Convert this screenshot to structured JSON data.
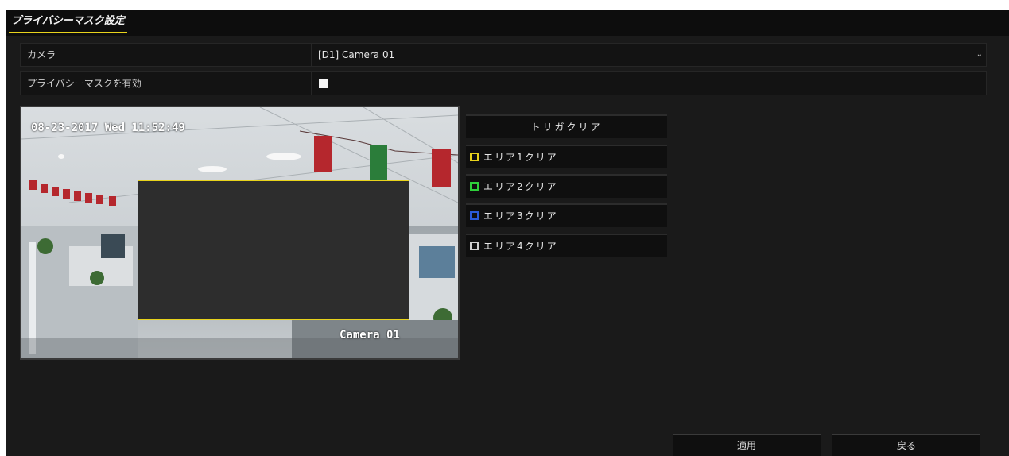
{
  "tab": {
    "label": "プライバシーマスク設定"
  },
  "form": {
    "camera_label": "カメラ",
    "camera_value": "[D1] Camera 01",
    "enable_label": "プライバシーマスクを有効"
  },
  "preview": {
    "osd_timestamp": "08-23-2017 Wed 11:52:49",
    "osd_camera_name": "Camera 01"
  },
  "clear_panel": {
    "trigger_clear": "トリガクリア",
    "areas": [
      {
        "label": "エリア1クリア",
        "color": "#e8d31c"
      },
      {
        "label": "エリア2クリア",
        "color": "#2ecf3a"
      },
      {
        "label": "エリア3クリア",
        "color": "#2a5bd8"
      },
      {
        "label": "エリア4クリア",
        "color": "#cfcfcf"
      }
    ]
  },
  "footer": {
    "apply_label": "適用",
    "back_label": "戻る"
  },
  "colors": {
    "accent": "#e8d31c",
    "background": "#1a1a1a"
  }
}
